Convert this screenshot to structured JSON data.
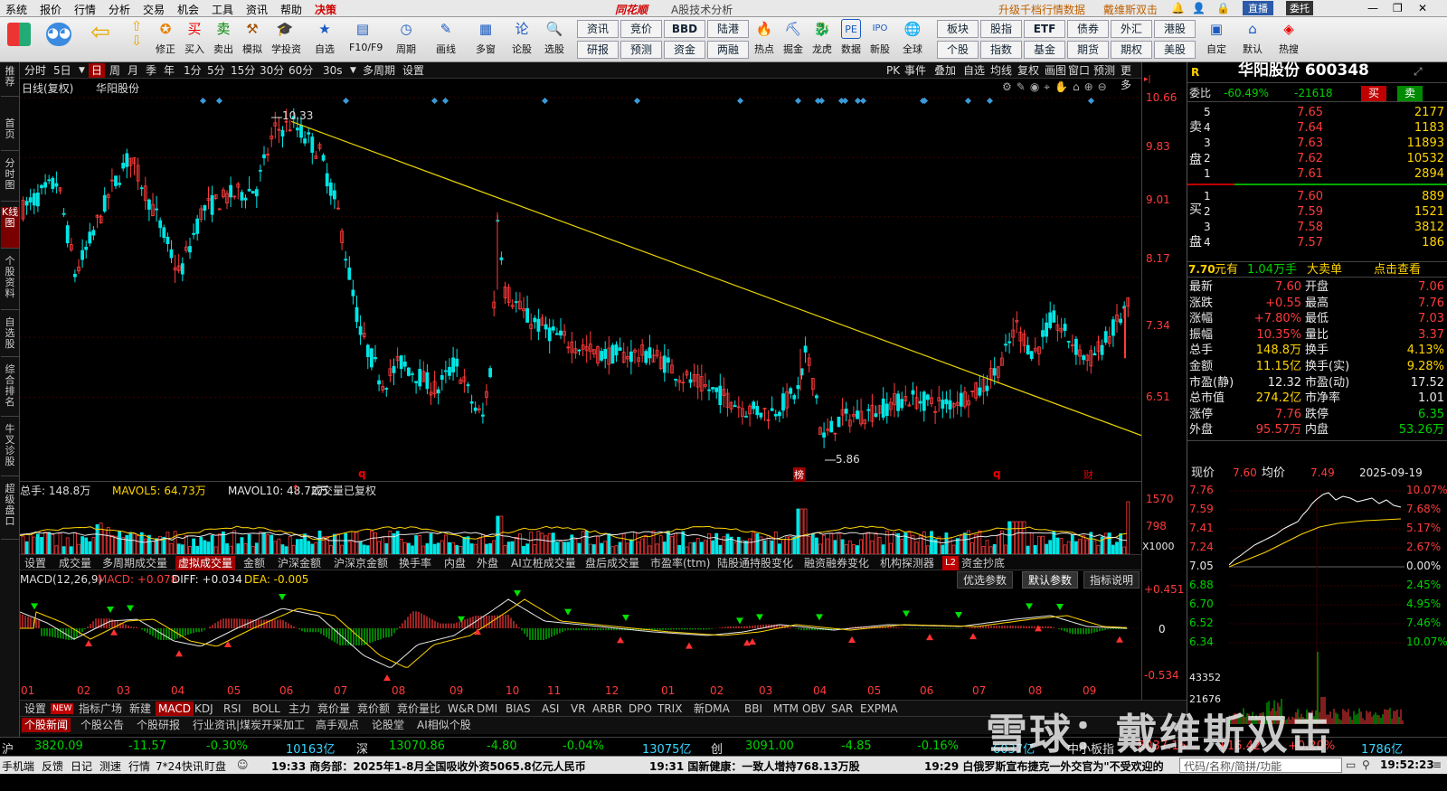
{
  "menubar": {
    "items": [
      "系统",
      "报价",
      "行情",
      "分析",
      "交易",
      "机会",
      "工具",
      "资讯",
      "帮助",
      "决策"
    ],
    "brand": "同花顺",
    "subtitle": "A股技术分析",
    "promo1": "升级千档行情数据",
    "promo2": "戴维斯双击",
    "live": "直播",
    "delegate": "委托"
  },
  "toolbar": {
    "buttons": [
      "修正",
      "买入",
      "卖出",
      "模拟",
      "学投资",
      "自选",
      "F10/F9",
      "周期",
      "画线",
      "多窗",
      "论股",
      "选股"
    ],
    "quick_top": [
      "资讯",
      "竞价",
      "BBD",
      "陆港"
    ],
    "quick_bottom": [
      "研报",
      "预测",
      "资金",
      "两融"
    ],
    "buttons2": [
      "热点",
      "掘金",
      "龙虎",
      "数据",
      "新股",
      "全球"
    ],
    "quick2_top": [
      "板块",
      "股指",
      "ETF",
      "债券",
      "外汇",
      "港股"
    ],
    "quick2_bottom": [
      "个股",
      "指数",
      "基金",
      "期货",
      "期权",
      "美股"
    ],
    "buttons3": [
      "自定",
      "默认",
      "热搜"
    ]
  },
  "leftnav": [
    "推荐",
    "首页",
    "分时图",
    "K线图",
    "个股资料",
    "自选股",
    "综合排名",
    "牛叉诊股",
    "超级盘口"
  ],
  "chart_toolbar": {
    "periods": [
      "分时",
      "5日",
      "日",
      "周",
      "月",
      "季",
      "年",
      "1分",
      "5分",
      "15分",
      "30分",
      "60分",
      "30s",
      "多周期",
      "设置"
    ],
    "active": "日",
    "right": [
      "PK",
      "事件",
      "叠加",
      "自选",
      "均线",
      "复权",
      "画图",
      "窗口",
      "预测",
      "更多"
    ]
  },
  "chart_header": {
    "left": "日线(复权)",
    "name": "华阳股份"
  },
  "price_axis": [
    "10.66",
    "9.83",
    "9.01",
    "8.17",
    "7.34",
    "6.51"
  ],
  "price_labels": {
    "high": "10.33",
    "low": "5.86"
  },
  "markers": {
    "q1": "q",
    "bang": "榜",
    "q2": "q",
    "cai": "财"
  },
  "volume": {
    "label_total": "总手: 148.8万",
    "label_ma5": "MAVOL5: 64.73万",
    "label_ma10": "MAVOL10: 48.72万",
    "note": "成交量已复权",
    "axis_top": "1570",
    "axis_mid": "798",
    "unit": "X1000"
  },
  "vol_tabs": [
    "设置",
    "成交量",
    "多周期成交量",
    "虚拟成交量",
    "金额",
    "沪深金额",
    "沪深京金额",
    "换手率",
    "内盘",
    "外盘",
    "AI立桩成交量",
    "盘后成交量",
    "市盈率(ttm)",
    "陆股通持股变化",
    "融资融券变化",
    "机构探测器",
    "L2",
    "资金抄底"
  ],
  "vol_tabs_active": "虚拟成交量",
  "macd": {
    "label": "MACD(12,26,9)",
    "macd": "MACD: +0.078",
    "diff": "DIFF: +0.034",
    "dea": "DEA: -0.005",
    "axis_top": "+0.451",
    "axis_zero": "0",
    "axis_bot": "-0.534",
    "buttons": [
      "优选参数",
      "默认参数",
      "指标说明"
    ]
  },
  "xaxis": [
    "01",
    "02",
    "03",
    "04",
    "05",
    "06",
    "07",
    "08",
    "09",
    "10",
    "11",
    "12",
    "01",
    "02",
    "03",
    "04",
    "05",
    "06",
    "07",
    "08",
    "09"
  ],
  "bottom_tabs": [
    "设置",
    "NEW",
    "指标广场",
    "新建",
    "MACD",
    "KDJ",
    "RSI",
    "BOLL",
    "主力",
    "竞价量",
    "竞价额",
    "竞价量比",
    "W&R",
    "DMI",
    "BIAS",
    "ASI",
    "VR",
    "ARBR",
    "DPO",
    "TRIX",
    "新DMA",
    "BBI",
    "MTM",
    "OBV",
    "SAR",
    "EXPMA"
  ],
  "bottom_tabs_active": "MACD",
  "news_tabs": [
    "个股新闻",
    "个股公告",
    "个股研报",
    "行业资讯|煤炭开采加工",
    "高手观点",
    "论股堂",
    "AI相似个股"
  ],
  "news_tabs_active": "个股新闻",
  "rpanel": {
    "tag": "R",
    "title": "华阳股份 600348",
    "weibi_label": "委比",
    "weibi_pct": "-60.49%",
    "weibi_val": "-21618",
    "buy": "买",
    "sell": "卖",
    "sell_side_label": "卖盘",
    "buy_side_label": "买盘",
    "asks": [
      {
        "lvl": "5",
        "price": "7.65",
        "vol": "2177"
      },
      {
        "lvl": "4",
        "price": "7.64",
        "vol": "1183"
      },
      {
        "lvl": "3",
        "price": "7.63",
        "vol": "11893"
      },
      {
        "lvl": "2",
        "price": "7.62",
        "vol": "10532"
      },
      {
        "lvl": "1",
        "price": "7.61",
        "vol": "2894"
      }
    ],
    "bids": [
      {
        "lvl": "1",
        "price": "7.60",
        "vol": "889"
      },
      {
        "lvl": "2",
        "price": "7.59",
        "vol": "1521"
      },
      {
        "lvl": "3",
        "price": "7.58",
        "vol": "3812"
      },
      {
        "lvl": "4",
        "price": "7.57",
        "vol": "186"
      }
    ],
    "bigorder": {
      "price": "7.70",
      "unit": "元有",
      "amount": "1.04万手",
      "type": "大卖单",
      "action": "点击查看"
    },
    "stats": [
      [
        "最新",
        "7.60",
        "开盘",
        "7.06"
      ],
      [
        "涨跌",
        "+0.55",
        "最高",
        "7.76"
      ],
      [
        "涨幅",
        "+7.80%",
        "最低",
        "7.03"
      ],
      [
        "振幅",
        "10.35%",
        "量比",
        "3.37"
      ],
      [
        "总手",
        "148.8万",
        "换手",
        "4.13%"
      ],
      [
        "金额",
        "11.15亿",
        "换手(实)",
        "9.28%"
      ],
      [
        "市盈(静)",
        "12.32",
        "市盈(动)",
        "17.52"
      ],
      [
        "总市值",
        "274.2亿",
        "市净率",
        "1.01"
      ],
      [
        "涨停",
        "7.76",
        "跌停",
        "6.35"
      ],
      [
        "外盘",
        "95.57万",
        "内盘",
        "53.26万"
      ]
    ],
    "mini": {
      "now_label": "现价",
      "now": "7.60",
      "avg_label": "均价",
      "avg": "7.49",
      "date": "2025-09-19",
      "left_axis": [
        "7.76",
        "7.59",
        "7.41",
        "7.24",
        "7.05",
        "6.88",
        "6.70",
        "6.52",
        "6.34"
      ],
      "right_axis": [
        "10.07%",
        "7.68%",
        "5.17%",
        "2.67%",
        "0.00%",
        "2.45%",
        "4.95%",
        "7.46%",
        "10.07%"
      ],
      "vol_axis": [
        "43352",
        "21676"
      ]
    }
  },
  "index_bar": {
    "sh_label": "沪",
    "sh": "3820.09",
    "sh_chg": "-11.57",
    "sh_pct": "-0.30%",
    "sh_amt": "10163亿",
    "sz_label": "深",
    "sz": "13070.86",
    "sz_chg": "-4.80",
    "sz_pct": "-0.04%",
    "sz_amt": "13075亿",
    "cy_label": "创",
    "cy": "3091.00",
    "cy_chg": "-4.85",
    "cy_pct": "-0.16%",
    "cy_amt": "6037亿",
    "zx_label": "中小板指",
    "zx": "8037.16",
    "zx_chg": "+16.42",
    "zx_pct": "+0.20%",
    "zx_amt": "1786亿"
  },
  "statusbar": {
    "items": [
      "手机端",
      "反馈",
      "日记",
      "测速",
      "行情",
      "7*24快讯",
      "盯盘"
    ],
    "news1": "19:33 商务部：2025年1-8月全国吸收外资5065.8亿元人民币",
    "news2": "19:31 国新健康：一致人增持768.13万股",
    "news3": "19:29 白俄罗斯宣布捷克一外交官为\"不受欢迎的",
    "search": "代码/名称/简拼/功能",
    "time": "19:52:23"
  },
  "watermark": "雪球：戴维斯双击"
}
